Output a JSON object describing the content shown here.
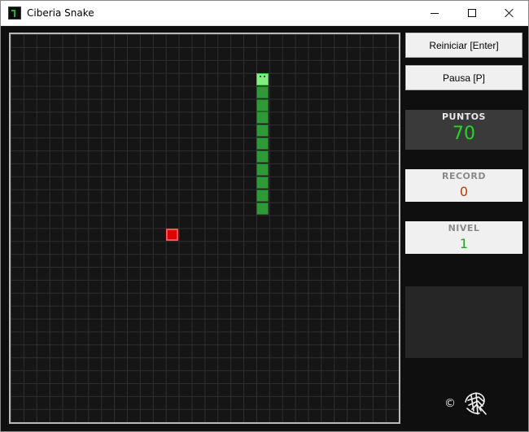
{
  "window": {
    "title": "Ciberia Snake",
    "controls": {
      "minimize": "minimize-icon",
      "maximize": "maximize-icon",
      "close": "close-icon"
    }
  },
  "board": {
    "grid": {
      "columns": 30,
      "rows": 30
    },
    "snake": [
      {
        "col": 19,
        "row": 3,
        "head": true
      },
      {
        "col": 19,
        "row": 4
      },
      {
        "col": 19,
        "row": 5
      },
      {
        "col": 19,
        "row": 6
      },
      {
        "col": 19,
        "row": 7
      },
      {
        "col": 19,
        "row": 8
      },
      {
        "col": 19,
        "row": 9
      },
      {
        "col": 19,
        "row": 10
      },
      {
        "col": 19,
        "row": 11
      },
      {
        "col": 19,
        "row": 12
      },
      {
        "col": 19,
        "row": 13
      }
    ],
    "food": {
      "col": 12,
      "row": 15
    },
    "colors": {
      "snake": "#2c9b35",
      "snake_head": "#7ff07f",
      "food": "#e00000",
      "grid": "#2e2e2e",
      "background": "#151515"
    }
  },
  "controls": {
    "restart_label": "Reiniciar [Enter]",
    "pause_label": "Pausa  [P]"
  },
  "stats": {
    "score_label": "PUNTOS",
    "score_value": "70",
    "record_label": "RECORD",
    "record_value": "0",
    "level_label": "NIVEL",
    "level_value": "1"
  },
  "footer": {
    "copyright_symbol": "©",
    "logo": "author-logo-icon"
  }
}
